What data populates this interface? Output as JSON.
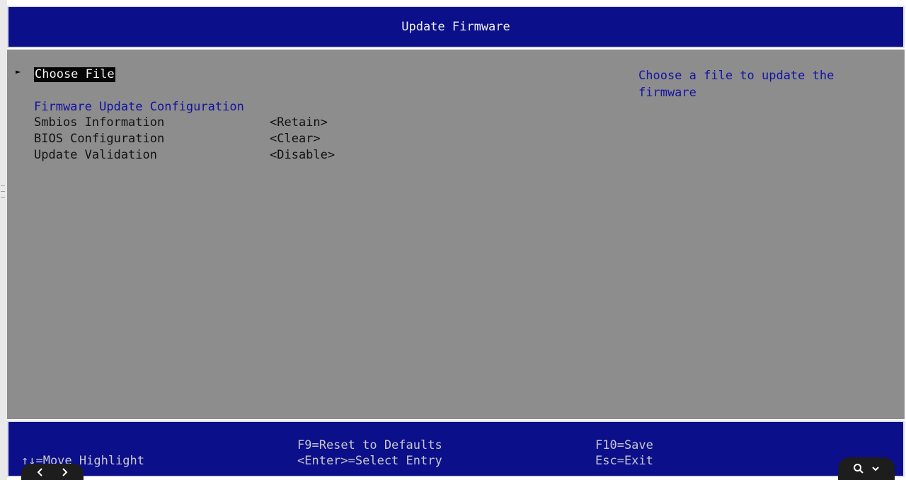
{
  "header": {
    "title": "Update Firmware"
  },
  "menu": {
    "selected_item": "Choose File",
    "section_title": "Firmware Update Configuration",
    "rows": [
      {
        "label": "Smbios Information",
        "value": "<Retain>"
      },
      {
        "label": "BIOS Configuration",
        "value": "<Clear>"
      },
      {
        "label": "Update Validation",
        "value": "<Disable>"
      }
    ]
  },
  "help": {
    "text": "Choose a file to update the\nfirmware"
  },
  "footer": {
    "move_highlight": "↑↓=Move Highlight",
    "reset_defaults": "F9=Reset to Defaults",
    "select_entry": "<Enter>=Select Entry",
    "save": "F10=Save",
    "exit": "Esc=Exit"
  },
  "overlay": {
    "nav_icons": [
      "chevron-left-icon",
      "chevron-right-icon"
    ],
    "zoom_icons": [
      "search-icon",
      "chevron-down-icon"
    ]
  },
  "colors": {
    "bar_blue": "#0c0f8a",
    "body_gray": "#8d8d8d",
    "highlight_text": "#1515a5"
  }
}
